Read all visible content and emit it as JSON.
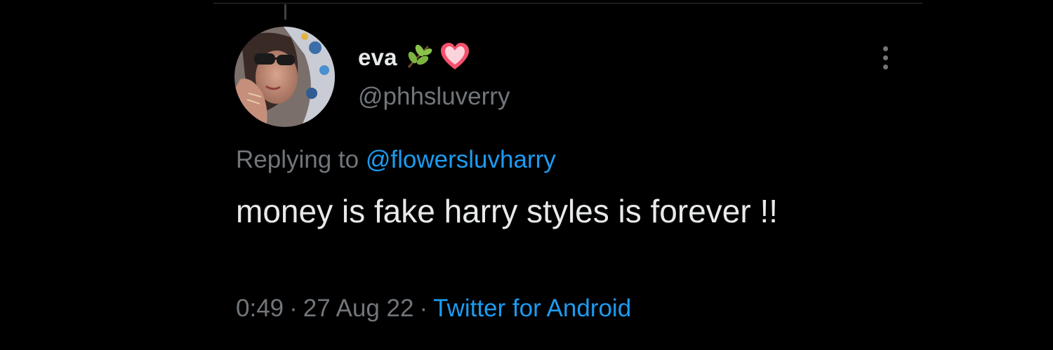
{
  "tweet": {
    "display_name": "eva",
    "handle": "@phhsluverry",
    "name_emojis": [
      "herb-emoji",
      "heart-emoji"
    ],
    "reply_prefix": "Replying to",
    "reply_to": "@flowersluvharry",
    "text": "money is fake harry styles is forever !!",
    "time": "0:49",
    "separator": "·",
    "date": "27 Aug 22",
    "source": "Twitter for Android"
  },
  "colors": {
    "background": "#000000",
    "text": "#e7e9ea",
    "secondary": "#71767b",
    "link": "#1d9bf0",
    "heart": "#f4516c",
    "herb": "#7cb342"
  }
}
